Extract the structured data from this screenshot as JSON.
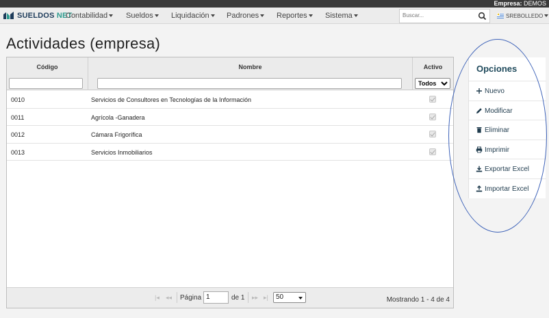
{
  "topbar": {
    "company_label": "Empresa:",
    "company_name": "DEMOS"
  },
  "logo": {
    "part1": "SUELDOS",
    "part2": "NET"
  },
  "nav": {
    "items": [
      "Contabilidad",
      "Sueldos",
      "Liquidación",
      "Padrones",
      "Reportes",
      "Sistema"
    ],
    "search_placeholder": "Buscar...",
    "user": "SREBOLLEDO"
  },
  "page": {
    "title": "Actividades (empresa)"
  },
  "grid": {
    "headers": {
      "code": "Código",
      "name": "Nombre",
      "active": "Activo"
    },
    "active_filter": "Todos",
    "rows": [
      {
        "code": "0010",
        "name": "Servicios de Consultores en Tecnologías de la Información",
        "active": true
      },
      {
        "code": "0011",
        "name": "Agrícola -Ganadera",
        "active": true
      },
      {
        "code": "0012",
        "name": "Cámara Frigorífica",
        "active": true
      },
      {
        "code": "0013",
        "name": "Servicios Inmobiliarios",
        "active": true
      }
    ],
    "pager": {
      "page_label": "Página",
      "page_value": "1",
      "of_label": "de 1",
      "page_size": "50",
      "showing": "Mostrando 1 - 4 de 4"
    }
  },
  "options": {
    "title": "Opciones",
    "items": [
      {
        "label": "Nuevo",
        "icon": "plus-icon"
      },
      {
        "label": "Modificar",
        "icon": "pencil-icon"
      },
      {
        "label": "Eliminar",
        "icon": "trash-icon"
      },
      {
        "label": "Imprimir",
        "icon": "print-icon"
      },
      {
        "label": "Exportar Excel",
        "icon": "download-icon"
      },
      {
        "label": "Importar Excel",
        "icon": "upload-icon"
      }
    ]
  },
  "colors": {
    "accent": "#1f4a5c",
    "annotation": "#3d62b8",
    "logo_dark": "#1d3b5a",
    "logo_teal": "#2e9b8f"
  }
}
